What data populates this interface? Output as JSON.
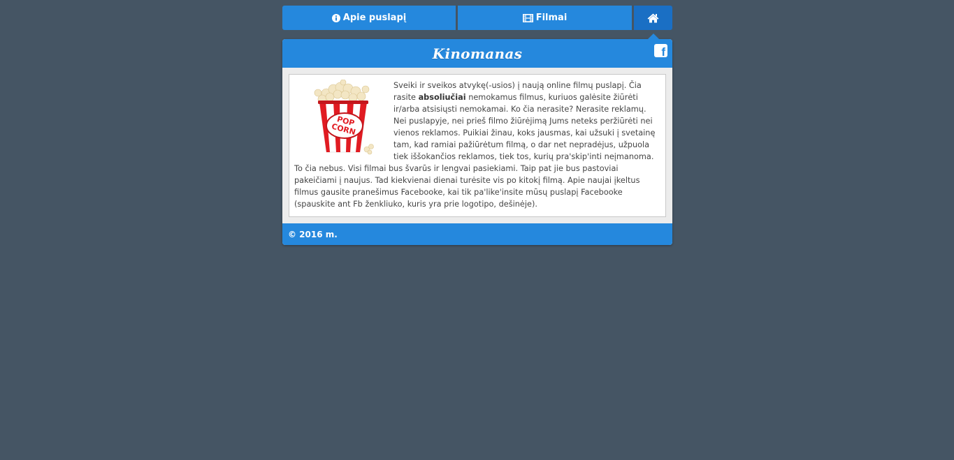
{
  "nav": {
    "about_label": "Apie puslapį",
    "films_label": "Filmai",
    "about_icon": "info-circle-icon",
    "films_icon": "film-icon",
    "home_icon": "home-icon"
  },
  "header": {
    "title": "Kinomanas",
    "fb_icon": "facebook-icon"
  },
  "content": {
    "image_alt": "popcorn-image",
    "text_part1": "Sveiki ir sveikos atvykę(-usios) į naują online filmų puslapį. Čia rasite ",
    "text_bold": "absoliučiai",
    "text_part2": " nemokamus filmus, kuriuos galėsite žiūrėti ir/arba atsisiųsti nemokamai. Ko čia nerasite? Nerasite reklamų. Nei puslapyje, nei prieš filmo žiūrėjimą Jums neteks peržiūrėti nei vienos reklamos. Puikiai žinau, koks jausmas, kai užsuki į svetainę tam, kad ramiai pažiūrėtum filmą, o dar net nepradėjus, užpuola tiek iššokančios reklamos, tiek tos, kurių pra'skip'inti neįmanoma. To čia nebus. Visi filmai bus švarūs ir lengvai pasiekiami. Taip pat jie bus pastoviai pakeičiami į naujus. Tad kiekvienai dienai turėsite vis po kitokį filmą. Apie naujai įkeltus filmus gausite pranešimus Facebooke, kai tik pa'like'insite mūsų puslapį Facebooke (spauskite ant Fb ženkliuko, kuris yra prie logotipo, dešinėje)."
  },
  "footer": {
    "text": "© 2016 m."
  },
  "colors": {
    "background": "#455564",
    "primary": "#2588dd",
    "home_active": "#1a6fc4"
  }
}
